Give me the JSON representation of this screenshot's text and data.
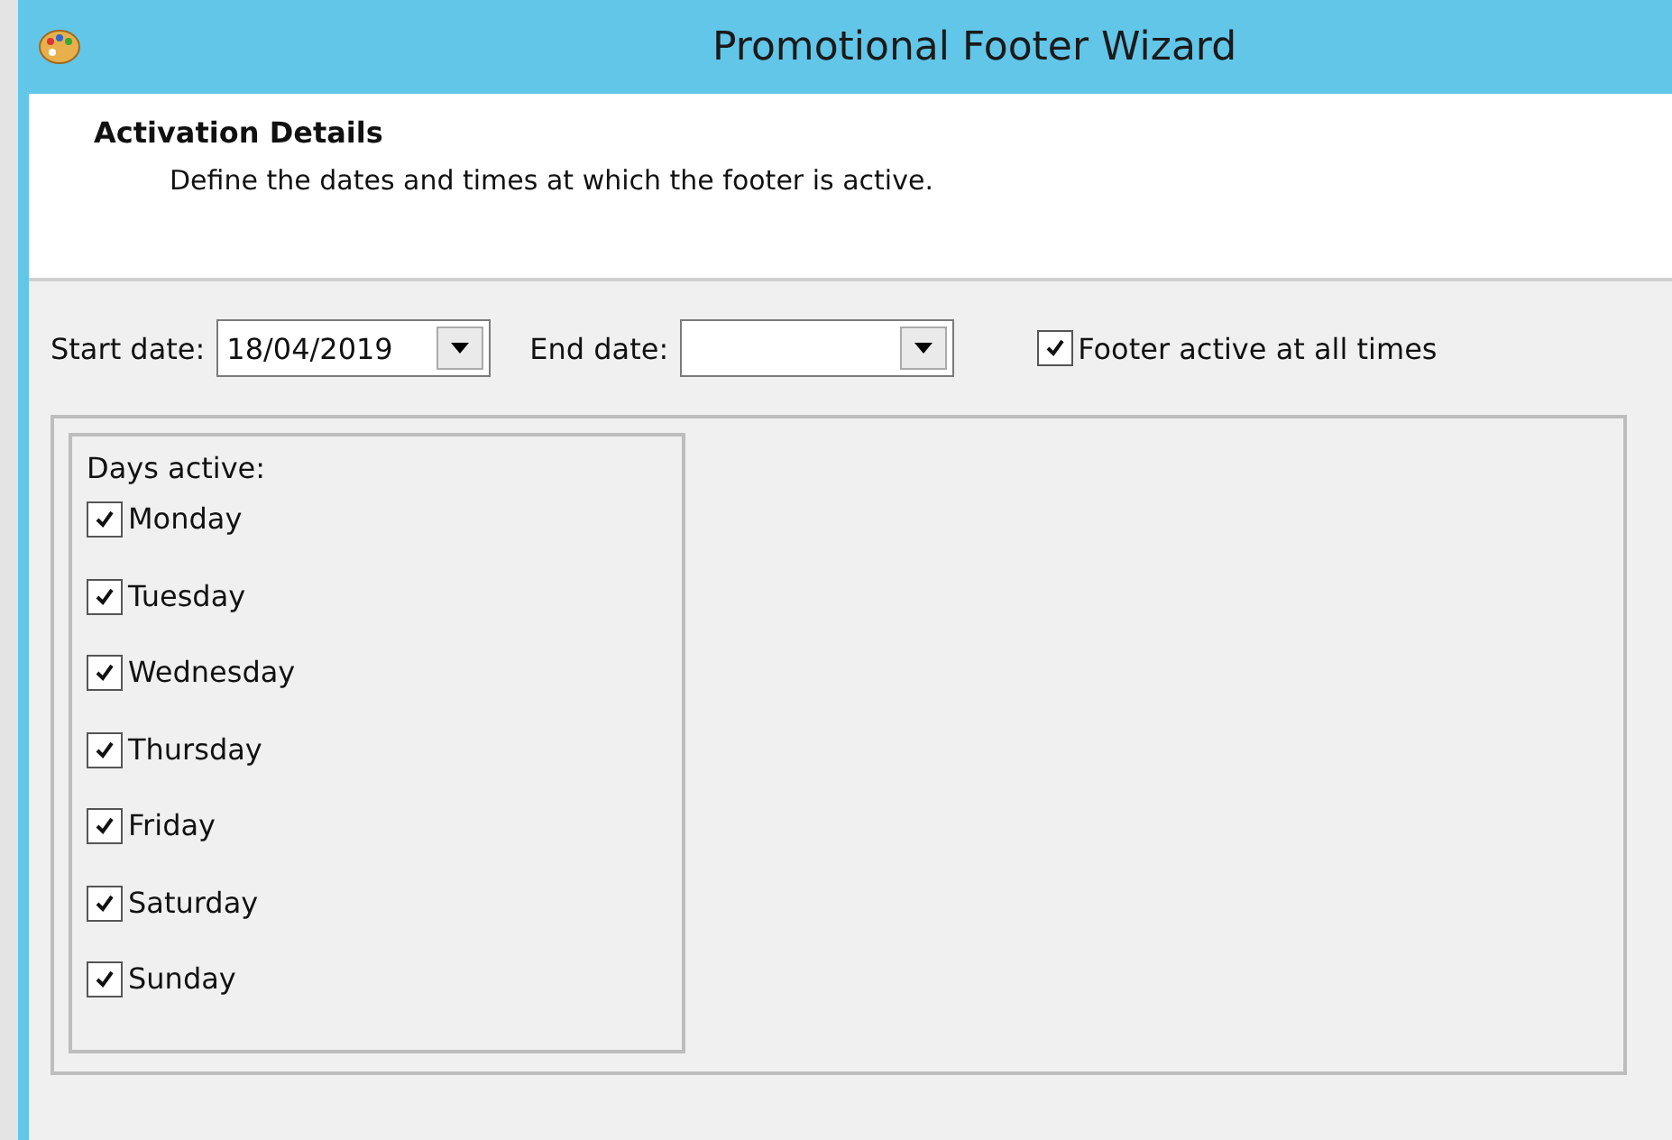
{
  "window": {
    "title": "Promotional Footer Wizard"
  },
  "header": {
    "title": "Activation Details",
    "description": "Define the dates and times at which the footer is active."
  },
  "start_date": {
    "label": "Start date:",
    "value": "18/04/2019"
  },
  "end_date": {
    "label": "End date:"
  },
  "always_active": {
    "label": "Footer active at all times",
    "checked": true
  },
  "days": {
    "title": "Days active:",
    "items": [
      {
        "label": "Monday",
        "checked": true
      },
      {
        "label": "Tuesday",
        "checked": true
      },
      {
        "label": "Wednesday",
        "checked": true
      },
      {
        "label": "Thursday",
        "checked": true
      },
      {
        "label": "Friday",
        "checked": true
      },
      {
        "label": "Saturday",
        "checked": true
      },
      {
        "label": "Sunday",
        "checked": true
      }
    ]
  }
}
